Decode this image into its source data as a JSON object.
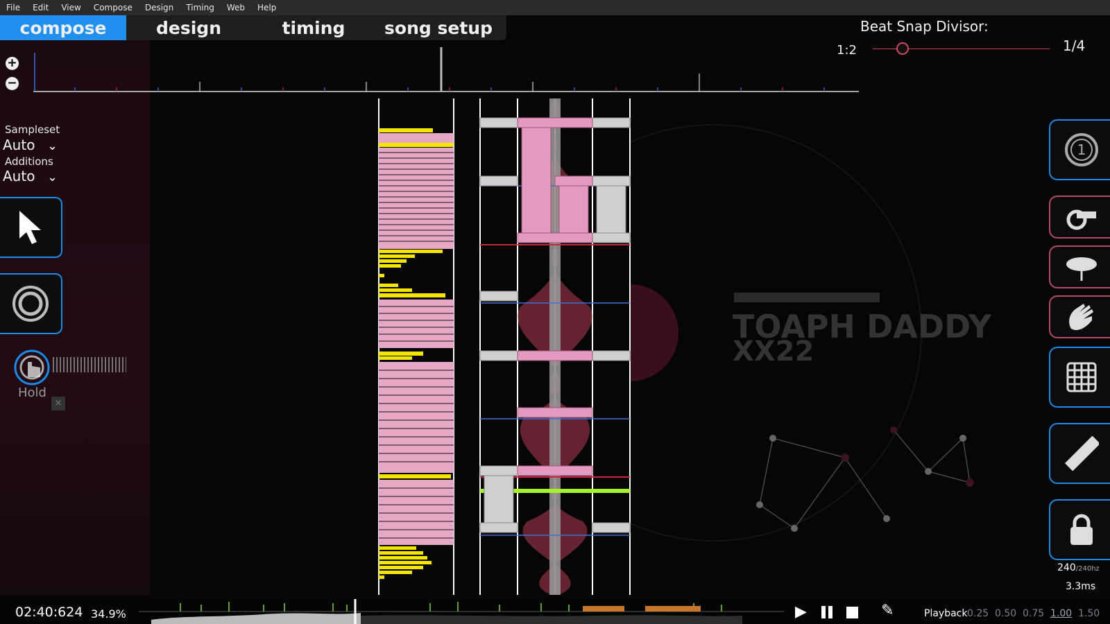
{
  "menu": [
    "File",
    "Edit",
    "View",
    "Compose",
    "Design",
    "Timing",
    "Web",
    "Help"
  ],
  "tabs": [
    {
      "label": "compose",
      "active": true
    },
    {
      "label": "design",
      "active": false
    },
    {
      "label": "timing",
      "active": false
    },
    {
      "label": "song setup",
      "active": false
    }
  ],
  "beat_snap": {
    "title": "Beat Snap Divisor:",
    "left_label": "1:2",
    "value": "1/4",
    "position_fraction": 0.17
  },
  "zoom": {
    "in_icon": "zoom-in-icon",
    "out_icon": "zoom-out-icon"
  },
  "left_panel": {
    "sampleset_label": "Sampleset",
    "sampleset_value": "Auto",
    "additions_label": "Additions",
    "additions_value": "Auto",
    "hold_label": "Hold"
  },
  "tools": [
    {
      "icon": "select-cursor-icon",
      "active": true
    },
    {
      "icon": "circle-note-icon",
      "active": false
    }
  ],
  "right_tools": [
    {
      "icon": "number-one-icon",
      "style": "blue"
    },
    {
      "icon": "whistle-icon",
      "style": "red"
    },
    {
      "icon": "cymbal-icon",
      "style": "red"
    },
    {
      "icon": "clap-icon",
      "style": "red"
    },
    {
      "icon": "grid-icon",
      "style": "blue"
    },
    {
      "icon": "ruler-icon",
      "style": "blue"
    },
    {
      "icon": "lock-icon",
      "style": "blue"
    }
  ],
  "background_text": {
    "line1": "TOAPH DADDY",
    "line2": "XX22"
  },
  "perf": {
    "fps": "240",
    "hz": "/240hz",
    "latency": "3.3ms"
  },
  "status": {
    "time": "02:40:624",
    "percent": "34.9%",
    "playback_label": "Playback",
    "speeds": [
      "0.25",
      "0.50",
      "0.75",
      "1.00",
      "1.50"
    ],
    "selected_speed": "1.00"
  },
  "colors": {
    "accent": "#1f8ff0",
    "pink": "#e7a7c6",
    "yellow": "#f4e600",
    "redline": "#c8283a",
    "blueline": "#3e6fd6",
    "green": "#a5f227"
  }
}
